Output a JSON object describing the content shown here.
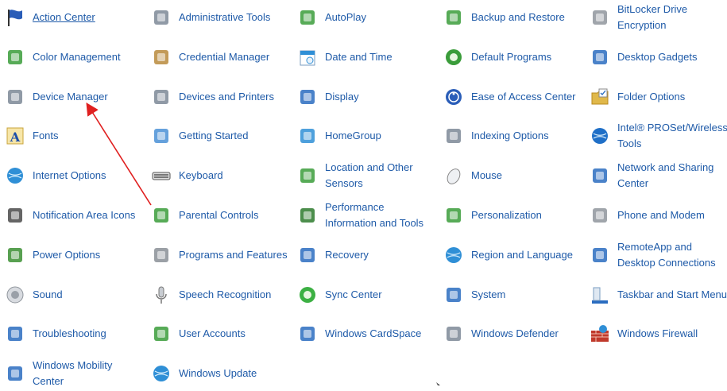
{
  "control_panel_items": [
    [
      {
        "label": "Action Center",
        "icon": "flag-icon",
        "color": "#2a5db8"
      },
      {
        "label": "Color Management",
        "icon": "color-management-icon",
        "color": "#3a9c3a"
      },
      {
        "label": "Device Manager",
        "icon": "device-manager-icon",
        "color": "#7c8896"
      },
      {
        "label": "Fonts",
        "icon": "fonts-icon",
        "color": "#d8a92a"
      },
      {
        "label": "Internet Options",
        "icon": "internet-options-icon",
        "color": "#2f8fd6"
      },
      {
        "label": "Notification Area Icons",
        "icon": "notification-area-icon",
        "color": "#4a4a4a"
      },
      {
        "label": "Power Options",
        "icon": "power-options-icon",
        "color": "#3b8f32"
      },
      {
        "label": "Sound",
        "icon": "sound-icon",
        "color": "#8f959c"
      },
      {
        "label": "Troubleshooting",
        "icon": "troubleshooting-icon",
        "color": "#2a6cc0"
      },
      {
        "label": "Windows Mobility Center",
        "icon": "mobility-center-icon",
        "color": "#2a6cc0"
      }
    ],
    [
      {
        "label": "Administrative Tools",
        "icon": "administrative-tools-icon",
        "color": "#7c8896"
      },
      {
        "label": "Credential Manager",
        "icon": "credential-manager-icon",
        "color": "#b88a3c"
      },
      {
        "label": "Devices and Printers",
        "icon": "devices-printers-icon",
        "color": "#7c8896"
      },
      {
        "label": "Getting Started",
        "icon": "getting-started-icon",
        "color": "#4a90d6"
      },
      {
        "label": "Keyboard",
        "icon": "keyboard-icon",
        "color": "#555555"
      },
      {
        "label": "Parental Controls",
        "icon": "parental-controls-icon",
        "color": "#3a9c3a"
      },
      {
        "label": "Programs and Features",
        "icon": "programs-features-icon",
        "color": "#8a8f96"
      },
      {
        "label": "Speech Recognition",
        "icon": "microphone-icon",
        "color": "#8f959c"
      },
      {
        "label": "User Accounts",
        "icon": "user-accounts-icon",
        "color": "#3a9c3a"
      },
      {
        "label": "Windows Update",
        "icon": "windows-update-icon",
        "color": "#2f8fd6"
      }
    ],
    [
      {
        "label": "AutoPlay",
        "icon": "autoplay-icon",
        "color": "#3a9c3a"
      },
      {
        "label": "Date and Time",
        "icon": "date-time-icon",
        "color": "#2f8fd6"
      },
      {
        "label": "Display",
        "icon": "display-icon",
        "color": "#2a6cc0"
      },
      {
        "label": "HomeGroup",
        "icon": "homegroup-icon",
        "color": "#2f8fd6"
      },
      {
        "label": "Location and Other Sensors",
        "icon": "location-sensors-icon",
        "color": "#3a9c3a"
      },
      {
        "label": "Performance Information and Tools",
        "icon": "performance-icon",
        "color": "#2d7a2d"
      },
      {
        "label": "Recovery",
        "icon": "recovery-icon",
        "color": "#2a6cc0"
      },
      {
        "label": "Sync Center",
        "icon": "sync-center-icon",
        "color": "#3cb043"
      },
      {
        "label": "Windows CardSpace",
        "icon": "cardspace-icon",
        "color": "#2a6cc0"
      }
    ],
    [
      {
        "label": "Backup and Restore",
        "icon": "backup-restore-icon",
        "color": "#3a9c3a"
      },
      {
        "label": "Default Programs",
        "icon": "default-programs-icon",
        "color": "#3a9c3a"
      },
      {
        "label": "Ease of Access Center",
        "icon": "ease-of-access-icon",
        "color": "#2a5db8"
      },
      {
        "label": "Indexing Options",
        "icon": "indexing-options-icon",
        "color": "#7c8896"
      },
      {
        "label": "Mouse",
        "icon": "mouse-icon",
        "color": "#8f959c"
      },
      {
        "label": "Personalization",
        "icon": "personalization-icon",
        "color": "#3a9c3a"
      },
      {
        "label": "Region and Language",
        "icon": "region-language-icon",
        "color": "#2f8fd6"
      },
      {
        "label": "System",
        "icon": "system-icon",
        "color": "#2a6cc0"
      },
      {
        "label": "Windows Defender",
        "icon": "windows-defender-icon",
        "color": "#7c8896"
      }
    ],
    [
      {
        "label": "BitLocker Drive Encryption",
        "icon": "bitlocker-icon",
        "color": "#8f959c"
      },
      {
        "label": "Desktop Gadgets",
        "icon": "desktop-gadgets-icon",
        "color": "#2a6cc0"
      },
      {
        "label": "Folder Options",
        "icon": "folder-options-icon",
        "color": "#e0b84a"
      },
      {
        "label": "Intel® PROSet/Wireless Tools",
        "icon": "intel-wireless-icon",
        "color": "#1f6fc7"
      },
      {
        "label": "Network and Sharing Center",
        "icon": "network-sharing-icon",
        "color": "#2a6cc0"
      },
      {
        "label": "Phone and Modem",
        "icon": "phone-modem-icon",
        "color": "#8f959c"
      },
      {
        "label": "RemoteApp and Desktop Connections",
        "icon": "remoteapp-icon",
        "color": "#2a6cc0"
      },
      {
        "label": "Taskbar and Start Menu",
        "icon": "taskbar-start-menu-icon",
        "color": "#2a6cc0"
      },
      {
        "label": "Windows Firewall",
        "icon": "windows-firewall-icon",
        "color": "#c0392b"
      }
    ]
  ],
  "annotation_arrow": {
    "color": "#e02020"
  },
  "link_color": "#1e5aa8"
}
